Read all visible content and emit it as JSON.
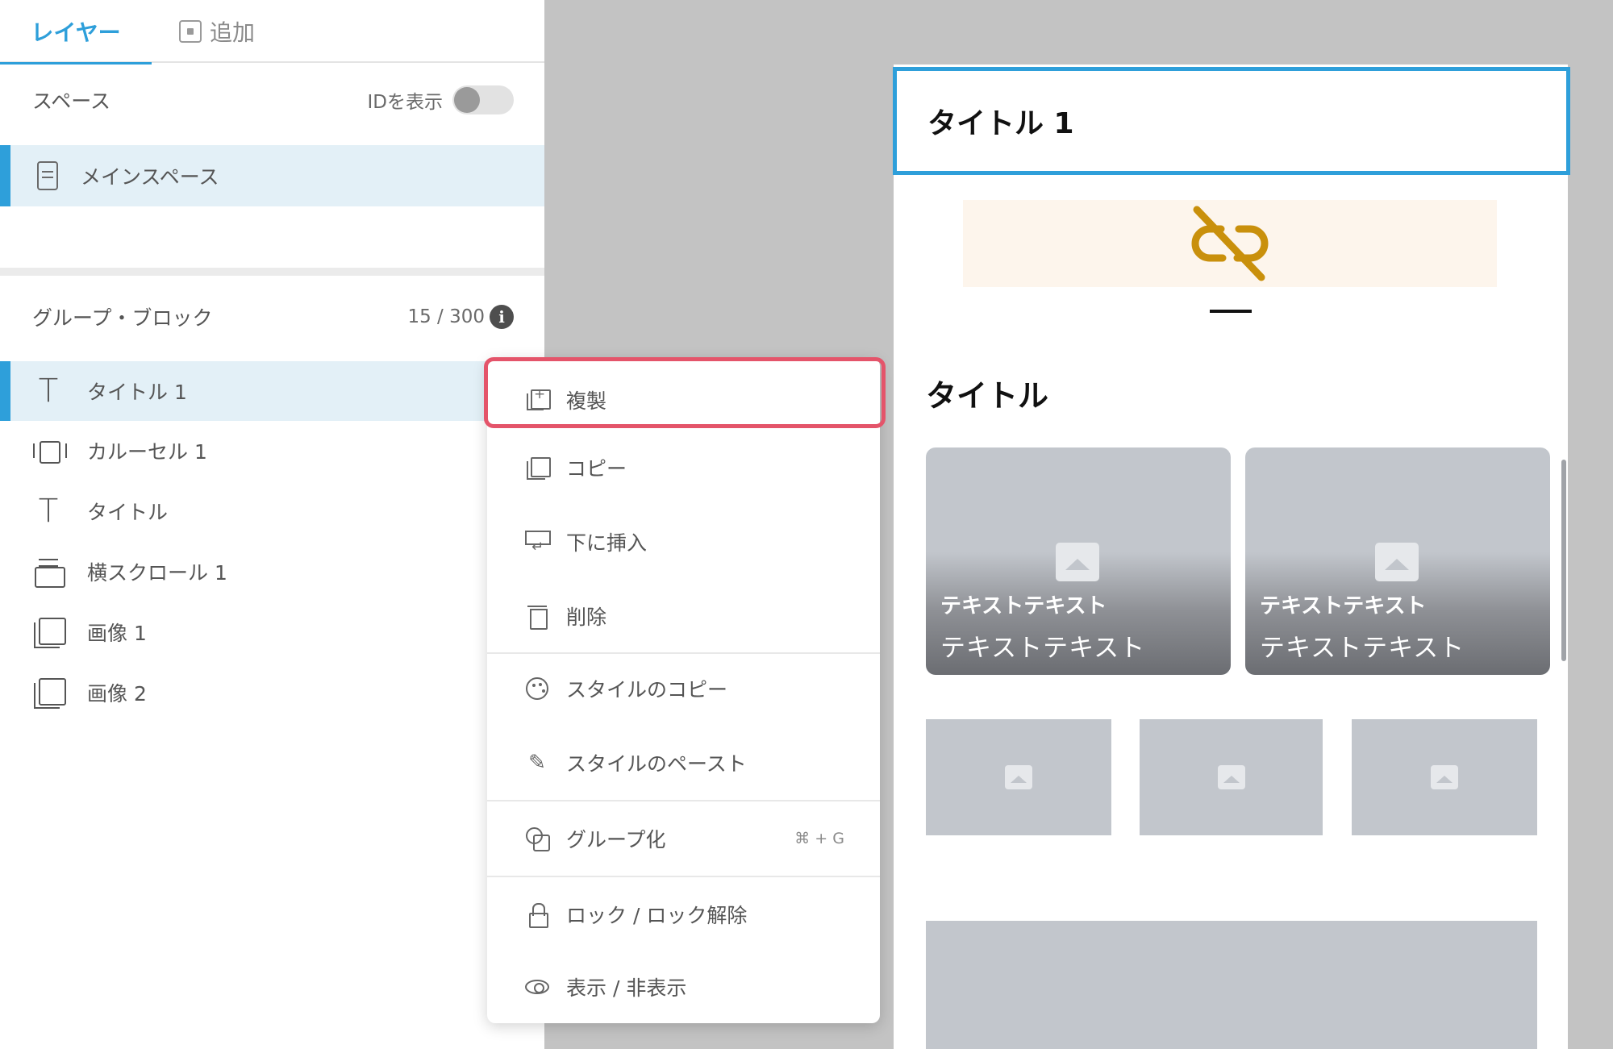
{
  "tabs": {
    "layers": "レイヤー",
    "add": "追加"
  },
  "space": {
    "heading": "スペース",
    "show_id_label": "IDを表示",
    "main_space": "メインスペース"
  },
  "group": {
    "heading": "グループ・ブロック",
    "count": "15 / 300",
    "info_glyph": "i"
  },
  "layers": [
    {
      "label": "タイトル 1",
      "icon": "text-icon"
    },
    {
      "label": "カルーセル 1",
      "icon": "carousel-icon"
    },
    {
      "label": "タイトル",
      "icon": "text-icon"
    },
    {
      "label": "横スクロール 1",
      "icon": "horizontal-scroll-icon"
    },
    {
      "label": "画像 1",
      "icon": "image-icon"
    },
    {
      "label": "画像 2",
      "icon": "image-icon"
    }
  ],
  "context_menu": {
    "duplicate": "複製",
    "copy": "コピー",
    "insert_below": "下に挿入",
    "delete": "削除",
    "copy_style": "スタイルのコピー",
    "paste_style": "スタイルのペースト",
    "group": "グループ化",
    "group_shortcut": "⌘ + G",
    "lock": "ロック / ロック解除",
    "visibility": "表示 / 非表示"
  },
  "preview": {
    "title_block": "タイトル 1",
    "section_title": "タイトル",
    "cards": [
      {
        "line1": "テキストテキスト",
        "line2": "テキストテキスト"
      },
      {
        "line1": "テキストテキスト",
        "line2": "テキストテキスト"
      }
    ]
  },
  "colors": {
    "accent": "#2e9fda",
    "highlight": "#e4546a",
    "broken_link": "#c9900c",
    "placeholder": "#c2c6cc",
    "canvas": "#c3c3c3"
  },
  "toggle_show_id": false
}
